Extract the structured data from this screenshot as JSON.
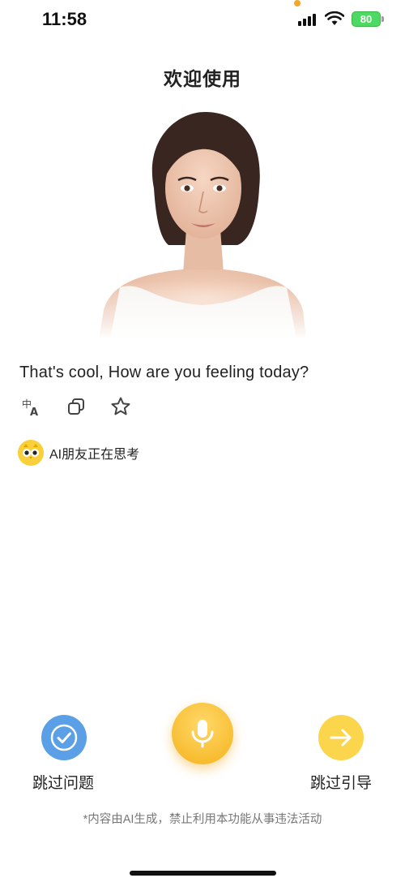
{
  "status_bar": {
    "time": "11:58",
    "battery": "80"
  },
  "header": {
    "title": "欢迎使用"
  },
  "chat": {
    "message": "That's cool, How are you feeling today?",
    "actions": [
      "translate-icon",
      "copy-icon",
      "star-icon"
    ],
    "thinking_text": "AI朋友正在思考"
  },
  "controls": {
    "skip_question_label": "跳过问题",
    "skip_guide_label": "跳过引导"
  },
  "footer": {
    "disclaimer": "*内容由AI生成，禁止利用本功能从事违法活动"
  },
  "colors": {
    "skip_question_bg": "#5b9fe6",
    "mic_bg": "#f5b21a",
    "skip_guide_bg": "#fbd64c"
  }
}
